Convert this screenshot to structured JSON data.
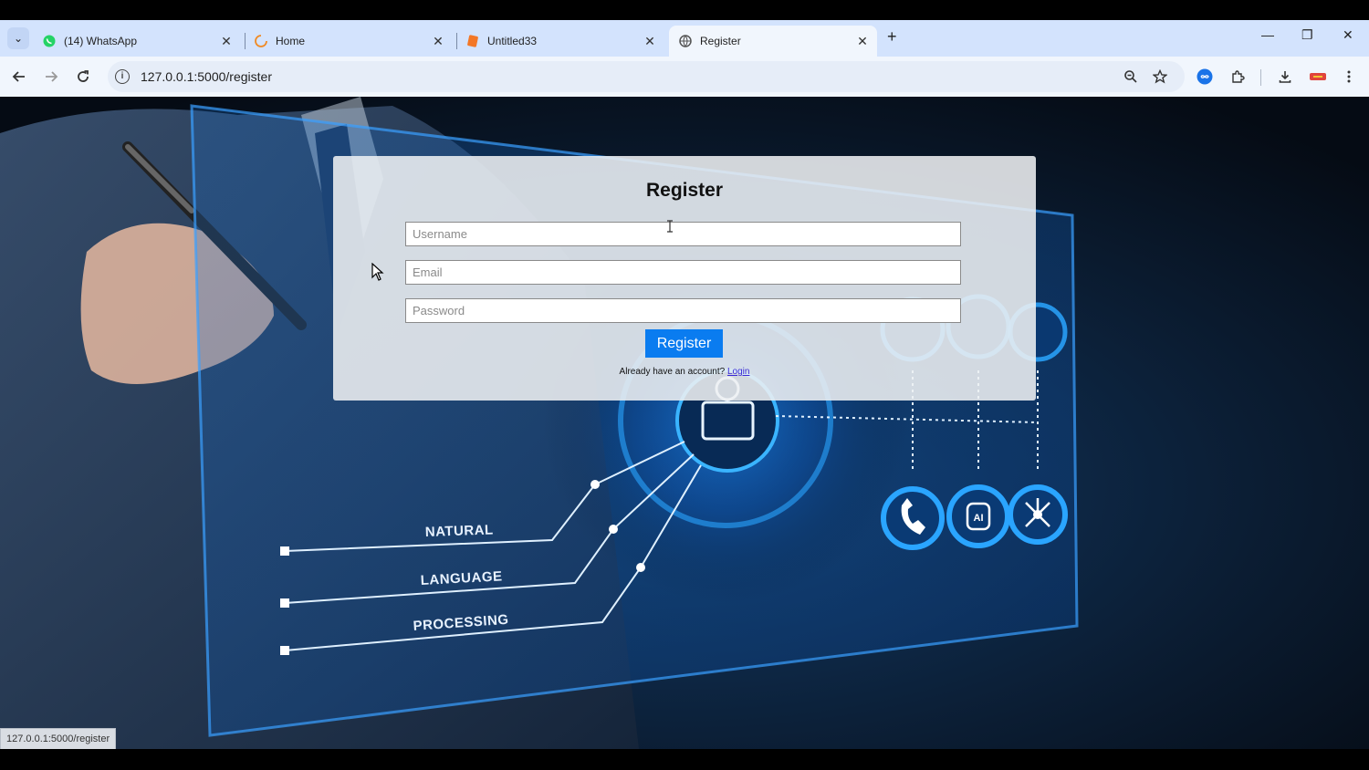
{
  "browser": {
    "tabs": [
      {
        "title": "(14) WhatsApp",
        "favicon": "whatsapp-icon",
        "active": false
      },
      {
        "title": "Home",
        "favicon": "loading-spinner-icon",
        "active": false
      },
      {
        "title": "Untitled33",
        "favicon": "jupyter-notebook-icon",
        "active": false
      },
      {
        "title": "Register",
        "favicon": "globe-icon",
        "active": true
      }
    ],
    "url": "127.0.0.1:5000/register",
    "status_url": "127.0.0.1:5000/register"
  },
  "register": {
    "title": "Register",
    "username_placeholder": "Username",
    "email_placeholder": "Email",
    "password_placeholder": "Password",
    "button_label": "Register",
    "account_prompt": "Already have an account?",
    "login_link": "Login"
  },
  "background": {
    "labels": [
      "NATURAL",
      "LANGUAGE",
      "PROCESSING"
    ]
  },
  "colors": {
    "accent": "#0a7cf0",
    "tab_strip": "#d3e3fd",
    "toolbar": "#f1f6fd"
  }
}
